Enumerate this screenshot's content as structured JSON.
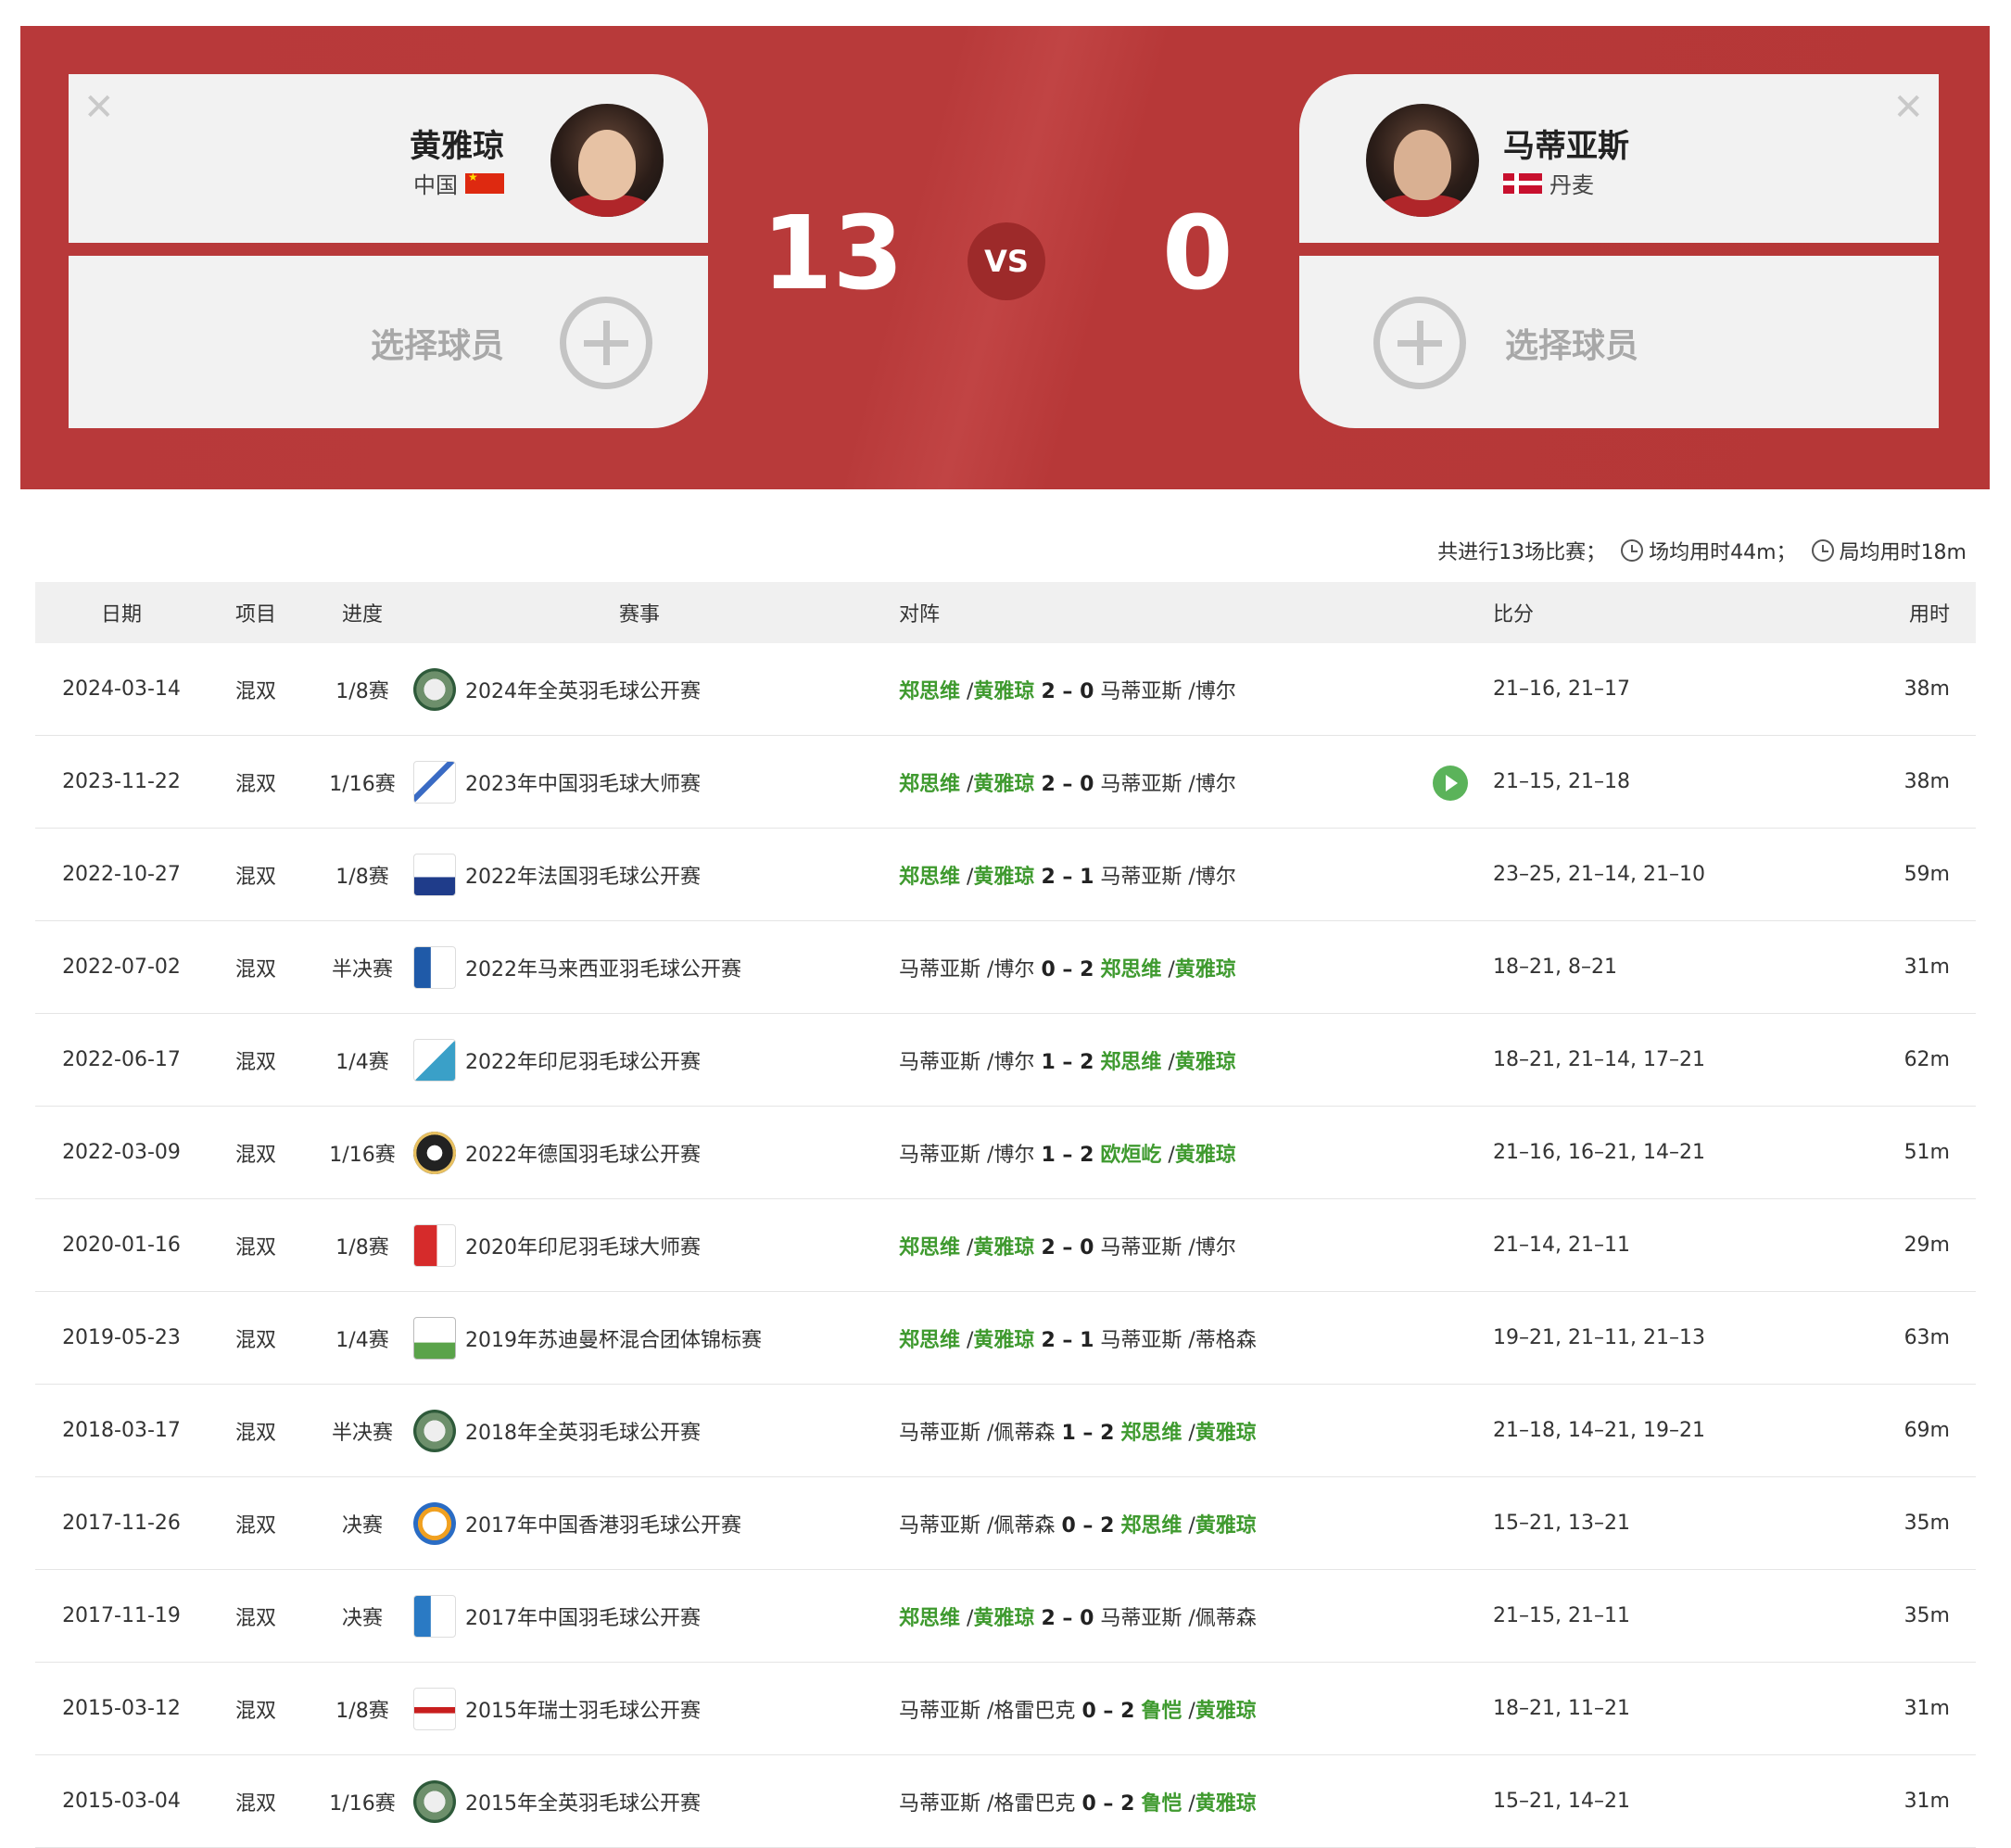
{
  "header": {
    "left_player": {
      "name": "黄雅琼",
      "country": "中国",
      "flag": "cn-flag"
    },
    "right_player": {
      "name": "马蒂亚斯",
      "country": "丹麦",
      "flag": "dk-flag"
    },
    "select_label": "选择球员",
    "score_left": "13",
    "score_right": "0",
    "vs_label": "VS",
    "colors": {
      "banner": "#b83a3a",
      "card": "#f2f2f2",
      "win_text": "#3f9a2f"
    }
  },
  "summary": {
    "total": "共进行13场比赛；",
    "avg_match": "场均用时44m；",
    "avg_game": "局均用时18m"
  },
  "table": {
    "headers": {
      "date": "日期",
      "event": "项目",
      "round": "进度",
      "tournament": "赛事",
      "matchup": "对阵",
      "score": "比分",
      "time": "用时"
    },
    "rows": [
      {
        "date": "2024-03-14",
        "event": "混双",
        "round": "1/8赛",
        "tournament": "2024年全英羽毛球公开赛",
        "logo": "allengland-logo",
        "p1": "郑思维",
        "p2": "黄雅琼",
        "sets": "2 – 0",
        "p3": "马蒂亚斯",
        "p4": "博尔",
        "winner_first": true,
        "score": "21–16, 21–17",
        "time": "38m"
      },
      {
        "date": "2023-11-22",
        "event": "混双",
        "round": "1/16赛",
        "tournament": "2023年中国羽毛球大师赛",
        "logo": "china-masters-logo",
        "p1": "郑思维",
        "p2": "黄雅琼",
        "sets": "2 – 0",
        "p3": "马蒂亚斯",
        "p4": "博尔",
        "winner_first": true,
        "score": "21–15, 21–18",
        "time": "38m",
        "video": true
      },
      {
        "date": "2022-10-27",
        "event": "混双",
        "round": "1/8赛",
        "tournament": "2022年法国羽毛球公开赛",
        "logo": "france-open-logo",
        "p1": "郑思维",
        "p2": "黄雅琼",
        "sets": "2 – 1",
        "p3": "马蒂亚斯",
        "p4": "博尔",
        "winner_first": true,
        "score": "23–25, 21–14, 21–10",
        "time": "59m"
      },
      {
        "date": "2022-07-02",
        "event": "混双",
        "round": "半决赛",
        "tournament": "2022年马来西亚羽毛球公开赛",
        "logo": "malaysia-open-logo",
        "p1": "马蒂亚斯",
        "p2": "博尔",
        "sets": "0 – 2",
        "p3": "郑思维",
        "p4": "黄雅琼",
        "winner_first": false,
        "score": "18–21, 8–21",
        "time": "31m"
      },
      {
        "date": "2022-06-17",
        "event": "混双",
        "round": "1/4赛",
        "tournament": "2022年印尼羽毛球公开赛",
        "logo": "indonesia-open-logo",
        "p1": "马蒂亚斯",
        "p2": "博尔",
        "sets": "1 – 2",
        "p3": "郑思维",
        "p4": "黄雅琼",
        "winner_first": false,
        "score": "18–21, 21–14, 17–21",
        "time": "62m"
      },
      {
        "date": "2022-03-09",
        "event": "混双",
        "round": "1/16赛",
        "tournament": "2022年德国羽毛球公开赛",
        "logo": "german-open-logo",
        "p1": "马蒂亚斯",
        "p2": "博尔",
        "sets": "1 – 2",
        "p3": "欧烜屹",
        "p4": "黄雅琼",
        "winner_first": false,
        "score": "21–16, 16–21, 14–21",
        "time": "51m"
      },
      {
        "date": "2020-01-16",
        "event": "混双",
        "round": "1/8赛",
        "tournament": "2020年印尼羽毛球大师赛",
        "logo": "indonesia-masters-logo",
        "p1": "郑思维",
        "p2": "黄雅琼",
        "sets": "2 – 0",
        "p3": "马蒂亚斯",
        "p4": "博尔",
        "winner_first": true,
        "score": "21–14, 21–11",
        "time": "29m"
      },
      {
        "date": "2019-05-23",
        "event": "混双",
        "round": "1/4赛",
        "tournament": "2019年苏迪曼杯混合团体锦标赛",
        "logo": "sudirman-cup-logo",
        "p1": "郑思维",
        "p2": "黄雅琼",
        "sets": "2 – 1",
        "p3": "马蒂亚斯",
        "p4": "蒂格森",
        "winner_first": true,
        "score": "19–21, 21–11, 21–13",
        "time": "63m"
      },
      {
        "date": "2018-03-17",
        "event": "混双",
        "round": "半决赛",
        "tournament": "2018年全英羽毛球公开赛",
        "logo": "allengland-logo",
        "p1": "马蒂亚斯",
        "p2": "佩蒂森",
        "sets": "1 – 2",
        "p3": "郑思维",
        "p4": "黄雅琼",
        "winner_first": false,
        "score": "21–18, 14–21, 19–21",
        "time": "69m"
      },
      {
        "date": "2017-11-26",
        "event": "混双",
        "round": "决赛",
        "tournament": "2017年中国香港羽毛球公开赛",
        "logo": "hongkong-open-logo",
        "p1": "马蒂亚斯",
        "p2": "佩蒂森",
        "sets": "0 – 2",
        "p3": "郑思维",
        "p4": "黄雅琼",
        "winner_first": false,
        "score": "15–21, 13–21",
        "time": "35m"
      },
      {
        "date": "2017-11-19",
        "event": "混双",
        "round": "决赛",
        "tournament": "2017年中国羽毛球公开赛",
        "logo": "china-open-logo",
        "p1": "郑思维",
        "p2": "黄雅琼",
        "sets": "2 – 0",
        "p3": "马蒂亚斯",
        "p4": "佩蒂森",
        "winner_first": true,
        "score": "21–15, 21–11",
        "time": "35m"
      },
      {
        "date": "2015-03-12",
        "event": "混双",
        "round": "1/8赛",
        "tournament": "2015年瑞士羽毛球公开赛",
        "logo": "swiss-open-logo",
        "p1": "马蒂亚斯",
        "p2": "格雷巴克",
        "sets": "0 – 2",
        "p3": "鲁恺",
        "p4": "黄雅琼",
        "winner_first": false,
        "score": "18–21, 11–21",
        "time": "31m"
      },
      {
        "date": "2015-03-04",
        "event": "混双",
        "round": "1/16赛",
        "tournament": "2015年全英羽毛球公开赛",
        "logo": "allengland-logo",
        "p1": "马蒂亚斯",
        "p2": "格雷巴克",
        "sets": "0 – 2",
        "p3": "鲁恺",
        "p4": "黄雅琼",
        "winner_first": false,
        "score": "15–21, 14–21",
        "time": "31m"
      }
    ]
  }
}
